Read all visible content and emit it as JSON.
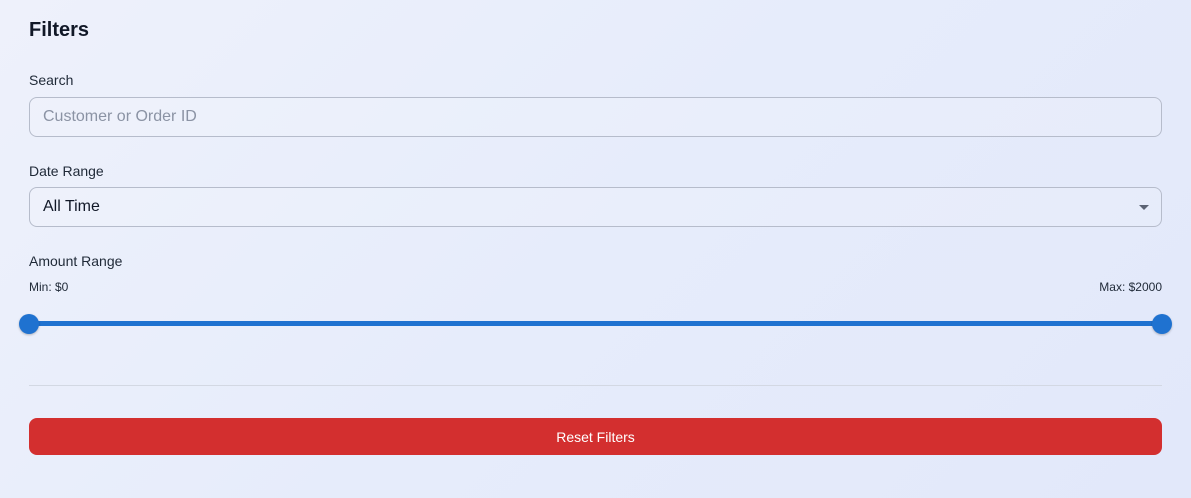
{
  "filters": {
    "title": "Filters",
    "search": {
      "label": "Search",
      "placeholder": "Customer or Order ID",
      "value": ""
    },
    "date_range": {
      "label": "Date Range",
      "selected": "All Time",
      "icon": "chevron-down-icon"
    },
    "amount_range": {
      "label": "Amount Range",
      "min_text": "Min: $0",
      "max_text": "Max: $2000",
      "min_value": 0,
      "max_value": 2000,
      "range_min": 0,
      "range_max": 2000
    },
    "reset_label": "Reset Filters"
  },
  "colors": {
    "accent": "#1f72d0",
    "danger": "#d32f2f"
  }
}
